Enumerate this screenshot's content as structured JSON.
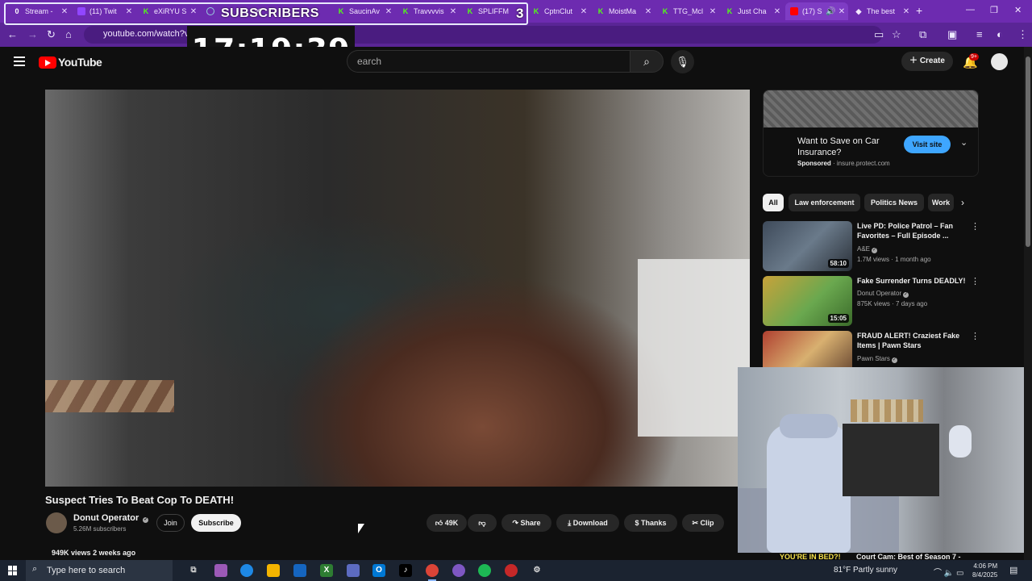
{
  "browser": {
    "tabs": [
      {
        "label": "Stream -",
        "icon": "obs-icon"
      },
      {
        "label": "(11) Twit",
        "icon": "twitch-icon"
      },
      {
        "label": "eXiRYU S",
        "icon": "kick-icon"
      },
      {
        "label": "",
        "icon": "loading-icon"
      },
      {
        "label": "SaucinAv",
        "icon": "kick-icon"
      },
      {
        "label": "Travvvvis",
        "icon": "kick-icon"
      },
      {
        "label": "SPLIFFM",
        "icon": "kick-icon"
      },
      {
        "label": "CptnClut",
        "icon": "kick-icon"
      },
      {
        "label": "MoistMa",
        "icon": "kick-icon"
      },
      {
        "label": "TTG_Mcl",
        "icon": "kick-icon"
      },
      {
        "label": "Just Cha",
        "icon": "kick-icon"
      },
      {
        "label": "(17) S",
        "icon": "youtube-icon"
      },
      {
        "label": "The best",
        "icon": "globe-icon"
      }
    ],
    "url": "youtube.com/watch?v=9c"
  },
  "overlay": {
    "subscribers_label": "SUBSCRIBERS",
    "subscribers_count": "3",
    "clock": "17:19:39"
  },
  "youtube": {
    "logo_text": "YouTube",
    "search_placeholder": "earch",
    "create_label": "Create",
    "notif_badge": "9+",
    "video": {
      "title": "Suspect Tries To Beat Cop To DEATH!",
      "channel": "Donut Operator",
      "subscribers": "5.26M subscribers",
      "join": "Join",
      "subscribe": "Subscribe",
      "likes": "49K",
      "share": "Share",
      "download": "Download",
      "thanks": "Thanks",
      "clip": "Clip",
      "views": "949K views",
      "age": "2 weeks ago"
    },
    "ad": {
      "title": "Want to Save on Car Insurance?",
      "sponsored": "Sponsored",
      "domain": "· insure.protect.com",
      "visit": "Visit site"
    },
    "chips": [
      "All",
      "Law enforcement",
      "Politics News",
      "Work"
    ],
    "recommendations": [
      {
        "title": "Live PD: Police Patrol – Fan Favorites – Full Episode ...",
        "channel": "A&E",
        "meta": "1.7M views · 1 month ago",
        "duration": "58:10"
      },
      {
        "title": "Fake Surrender Turns DEADLY!",
        "channel": "Donut Operator",
        "meta": "875K views · 7 days ago",
        "duration": "15:05"
      },
      {
        "title": "FRAUD ALERT! Craziest Fake Items | Pawn Stars",
        "channel": "Pawn Stars",
        "meta": "",
        "duration": ""
      }
    ],
    "next_title": "Court Cam: Best of Season 7 -"
  },
  "webcam": {
    "caption": "YOU'RE IN BED?!"
  },
  "taskbar": {
    "search_placeholder": "Type here to search",
    "weather": "81°F  Partly sunny",
    "time": "4:06 PM",
    "date": "8/4/2025"
  }
}
